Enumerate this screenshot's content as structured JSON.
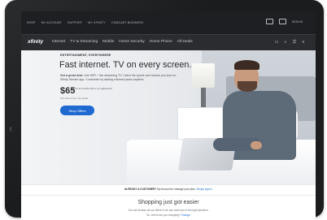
{
  "utility_bar": {
    "links": [
      "SHOP",
      "MY ACCOUNT",
      "SUPPORT",
      "MY XFINITY",
      "COMCAST BUSINESS"
    ],
    "sign_in": "SIGN IN"
  },
  "main_nav": {
    "logo": "xfinity",
    "items": [
      "Internet",
      "TV & Streaming",
      "Mobile",
      "Home Security",
      "Home Phone",
      "All Deals"
    ]
  },
  "hero": {
    "eyebrow": "ENTERTAINMENT, EVERYWHERE",
    "headline": "Fast internet. TV on every screen.",
    "body_strong": "Get a great deal:",
    "body": "Like WiFi + live streaming TV. Catch the sports and movies you love on Xfinity Stream app. Customize by adding channel packs anytime.",
    "price": "$65",
    "price_detail": "mo for 12 months with a 1-yr agreement",
    "fine_print": "Plus taxes & fees. See details",
    "cta": "Shop Offers"
  },
  "customer_strip": {
    "lead": "ALREADY A CUSTOMER?",
    "text": "My Account to manage your plan.",
    "link": "Simply sign in"
  },
  "shopping": {
    "heading": "Shopping just got easier",
    "line1": "You can browse all our offers or we can point you in the right direction.",
    "line2": "So, where are you shopping?",
    "line2_link": "Change"
  },
  "icons": {
    "mail": "mail-icon",
    "monitor": "monitor-icon",
    "cart": "cart-icon",
    "search": "search-icon",
    "language": "language-icon",
    "menu": "menu-icon"
  },
  "colors": {
    "brand_dark": "#1d1f22",
    "accent": "#1f69d1"
  }
}
